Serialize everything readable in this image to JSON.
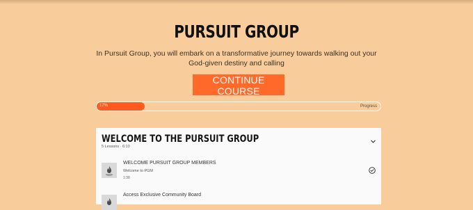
{
  "course": {
    "title": "PURSUIT GROUP",
    "description": "In Pursuit Group, you will embark on a transformative journey towards walking out your God-given destiny and calling",
    "cta_label": "CONTINUE COURSE"
  },
  "progress": {
    "percent_text": "17%",
    "value": 0.17,
    "label": "Progress"
  },
  "module": {
    "title": "WELCOME TO THE PURSUIT GROUP",
    "meta": "5 Lessons · 6:10",
    "lessons": [
      {
        "title": "WELCOME PURSUIT GROUP MEMBERS",
        "subtitle": "Welcome to PGM",
        "duration": "1:38",
        "completed": true,
        "thumb_icon": "flame-logo-icon"
      },
      {
        "title": "Access Exclusive Community Board",
        "subtitle": "",
        "duration": "",
        "completed": false,
        "thumb_icon": "flame-logo-icon"
      }
    ]
  },
  "colors": {
    "page_bg": "#f8cc9b",
    "accent": "#ff6a2a",
    "progress_fill": "#ff5a1e",
    "card_bg": "#fafafa"
  }
}
